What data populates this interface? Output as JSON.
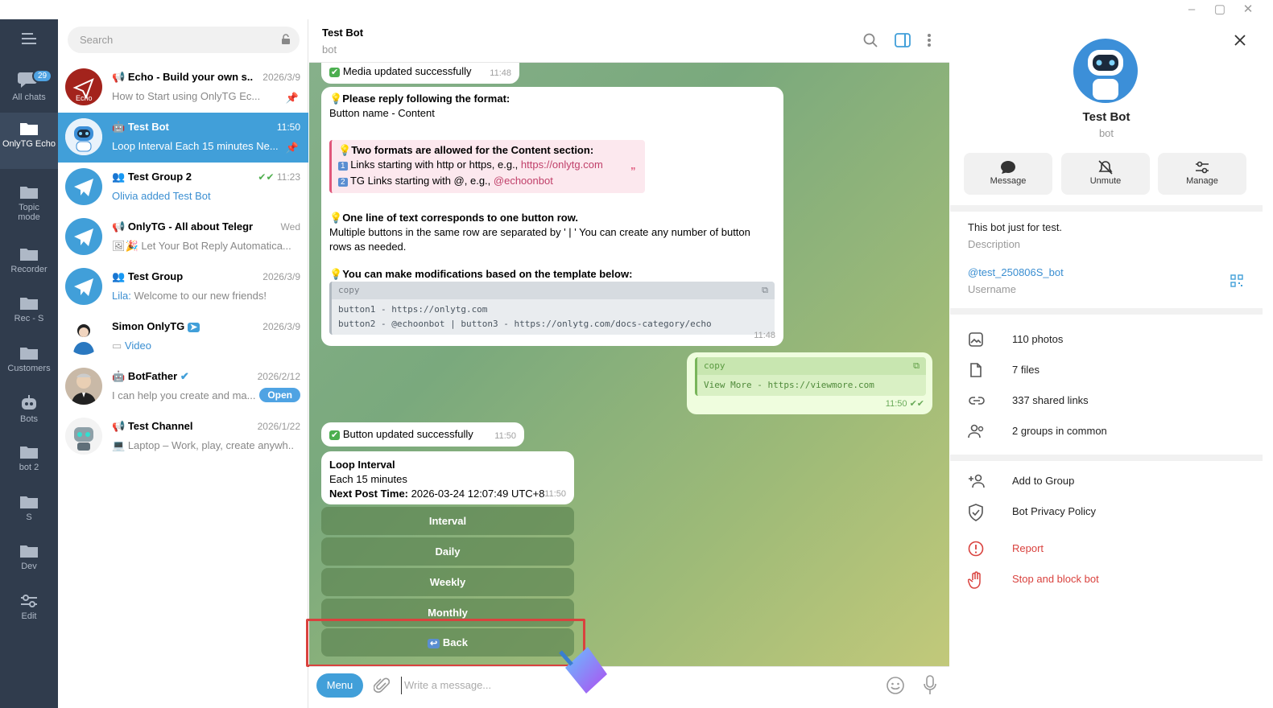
{
  "folders": [
    {
      "label": "All chats",
      "badge": "29",
      "icon": "chat-bubbles-icon"
    },
    {
      "label": "OnlyTG Echo",
      "icon": "folder-icon",
      "active": true
    },
    {
      "label": "Topic mode",
      "icon": "folder-icon"
    },
    {
      "label": "Recorder",
      "icon": "folder-icon"
    },
    {
      "label": "Rec - S",
      "icon": "folder-icon"
    },
    {
      "label": "Customers",
      "icon": "folder-icon"
    },
    {
      "label": "Bots",
      "icon": "bot-icon"
    },
    {
      "label": "bot 2",
      "icon": "folder-icon"
    },
    {
      "label": "S",
      "icon": "folder-icon"
    },
    {
      "label": "Dev",
      "icon": "folder-icon"
    },
    {
      "label": "Edit",
      "icon": "sliders-icon"
    }
  ],
  "search": {
    "placeholder": "Search"
  },
  "chats": [
    {
      "name": "Echo - Build your own s...",
      "time": "2026/3/9",
      "preview": "How to Start using OnlyTG Ec...",
      "type": "channel",
      "pinned": true
    },
    {
      "name": "Test Bot",
      "time": "11:50",
      "preview": "Loop Interval Each 15 minutes Ne...",
      "type": "bot",
      "pinned": true,
      "active": true
    },
    {
      "name": "Test Group 2",
      "time": "11:23",
      "preview": "Olivia added Test Bot",
      "type": "group"
    },
    {
      "name": "OnlyTG - All about Telegram",
      "time": "Wed",
      "preview": "Let Your Bot Reply Automatica...",
      "type": "channel"
    },
    {
      "name": "Test Group",
      "time": "2026/3/9",
      "preview_sender": "Lila:",
      "preview": "Welcome to our new friends!",
      "type": "group"
    },
    {
      "name": "Simon OnlyTG",
      "time": "2026/3/9",
      "preview": "Video",
      "type": "user"
    },
    {
      "name": "BotFather",
      "time": "2026/2/12",
      "preview": "I can help you create and ma...",
      "type": "bot",
      "open_label": "Open"
    },
    {
      "name": "Test Channel",
      "time": "2026/1/22",
      "preview": "Laptop – Work, play, create anywh...",
      "type": "channel"
    }
  ],
  "header": {
    "title": "Test Bot",
    "subtitle": "bot"
  },
  "messages": {
    "m1": {
      "text": "Media updated successfully",
      "time": "11:48"
    },
    "m2": {
      "l1": "Please reply following the format:",
      "l2": "Button name - Content",
      "q1": "Two formats are allowed for the Content section:",
      "q2": "Links starting with http or https, e.g., ",
      "q2link": "https://onlytg.com",
      "q3": "TG Links starting with @, e.g., ",
      "q3link": "@echoonbot",
      "l3": "One line of text corresponds to one button row.",
      "l4": "Multiple buttons in the same row are separated by ' | '  You can create any number of button rows as needed.",
      "l5": "You can make modifications based on the template below:",
      "code_hd": "copy",
      "code1": "button1 - https://onlytg.com",
      "code2": "button2 - @echoonbot | button3 - https://onlytg.com/docs-category/echo",
      "time": "11:48"
    },
    "m3": {
      "code_hd": "copy",
      "code1": "View More - https://viewmore.com",
      "time": "11:50"
    },
    "m4": {
      "text": "Button updated successfully",
      "time": "11:50"
    },
    "m5": {
      "title": "Loop Interval",
      "l2": "Each 15 minutes",
      "l3b": "Next Post Time:",
      "l3": " 2026-03-24 12:07:49 UTC+8",
      "time": "11:50"
    }
  },
  "keyboard": [
    "Interval",
    "Daily",
    "Weekly",
    "Monthly",
    "Back"
  ],
  "composer": {
    "menu": "Menu",
    "placeholder": "Write a message..."
  },
  "profile": {
    "name": "Test Bot",
    "status": "bot",
    "actions": [
      "Message",
      "Unmute",
      "Manage"
    ],
    "bio": "This bot just for test.",
    "bio_label": "Description",
    "username": "@test_250806S_bot",
    "username_label": "Username",
    "media": [
      "110 photos",
      "7 files",
      "337 shared links",
      "2 groups in common"
    ],
    "add_to_group": "Add to Group",
    "privacy": "Bot Privacy Policy",
    "report": "Report",
    "stop": "Stop and block bot"
  },
  "colors": {
    "accent": "#419fd9",
    "sidebar": "#303c4d",
    "danger": "#d9423e"
  }
}
